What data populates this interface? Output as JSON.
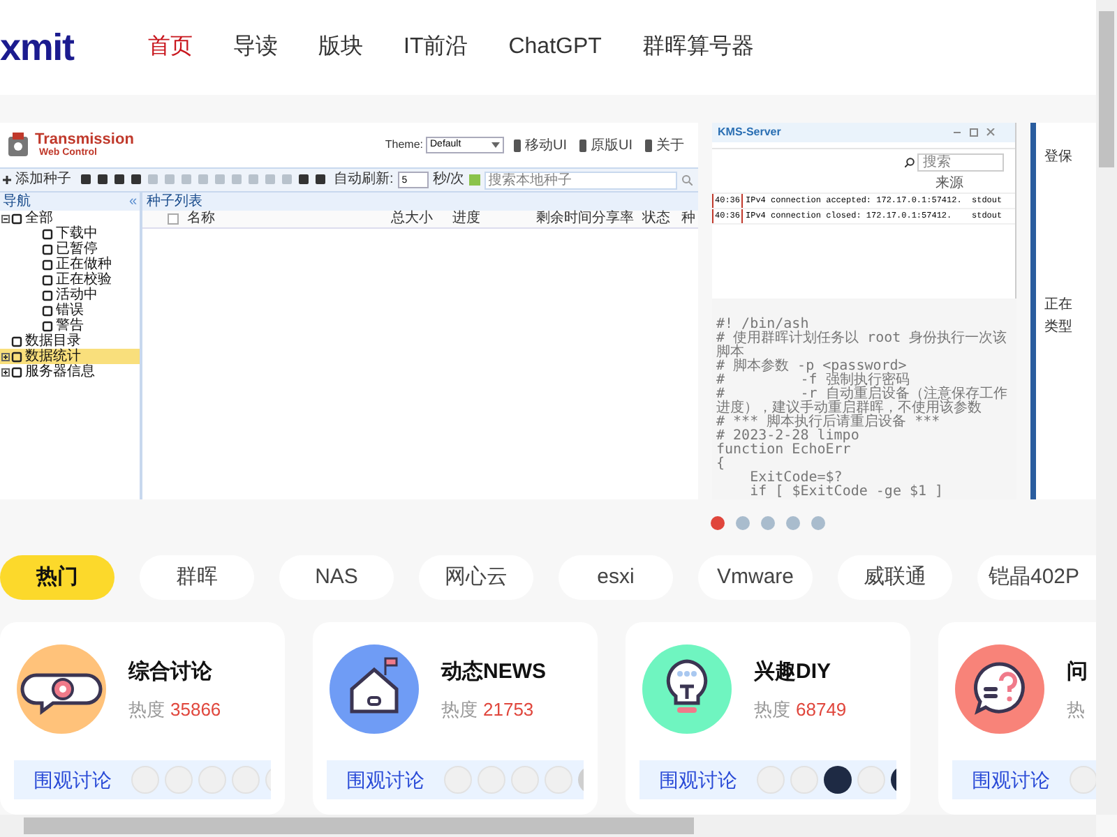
{
  "header": {
    "logo": "xmit",
    "nav": [
      {
        "label": "首页",
        "selected": true
      },
      {
        "label": "导读",
        "selected": false
      },
      {
        "label": "版块",
        "selected": false
      },
      {
        "label": "IT前沿",
        "selected": false
      },
      {
        "label": "ChatGPT",
        "selected": false
      },
      {
        "label": "群晖算号器",
        "selected": false
      }
    ]
  },
  "carousel": {
    "slides": [
      {
        "kind": "transmission",
        "app_title": "Transmission",
        "app_subtitle": "Web Control",
        "theme_label": "Theme:",
        "theme_value": "Default",
        "links": [
          "移动UI",
          "原版UI",
          "关于"
        ],
        "add_button": "添加种子",
        "refresh_label": "自动刷新:",
        "refresh_value": "5",
        "refresh_unit": "秒/次",
        "search_placeholder": "搜索本地种子",
        "nav_title": "导航",
        "nav_collapse": "«",
        "tree": [
          {
            "label": "全部",
            "expanded": true,
            "selected": false,
            "children": [
              {
                "label": "下载中",
                "selected": false
              },
              {
                "label": "已暂停",
                "selected": false
              },
              {
                "label": "正在做种",
                "selected": false
              },
              {
                "label": "正在校验",
                "selected": false
              },
              {
                "label": "活动中",
                "selected": false
              },
              {
                "label": "错误",
                "selected": false
              },
              {
                "label": "警告",
                "selected": false
              }
            ]
          },
          {
            "label": "数据目录",
            "selected": false
          },
          {
            "label": "数据统计",
            "expanded": false,
            "selected": true
          },
          {
            "label": "服务器信息",
            "expanded": false,
            "selected": false
          }
        ],
        "list_title": "种子列表",
        "columns": [
          "名称",
          "总大小",
          "进度",
          "剩余时间",
          "分享率",
          "状态",
          "种"
        ]
      },
      {
        "kind": "kms",
        "window_title": "KMS-Server",
        "search_placeholder": "搜索",
        "source_column": "来源",
        "log_rows": [
          {
            "time": "40:36",
            "message": "IPv4 connection accepted: 172.17.0.1:57412.",
            "source": "stdout"
          },
          {
            "time": "40:36",
            "message": "IPv4 connection closed: 172.17.0.1:57412.",
            "source": "stdout"
          }
        ],
        "script_lines": [
          "#! /bin/ash",
          "# 使用群晖计划任务以 root 身份执行一次该脚本",
          "# 脚本参数 -p <password>",
          "#         -f 强制执行密码",
          "#         -r 自动重启设备（注意保存工作进度），建议手动重启群晖，不使用该参数",
          "# *** 脚本执行后请重启设备 ***",
          "# 2023-2-28 limpo",
          "function EchoErr",
          "{",
          "    ExitCode=$?",
          "    if [ $ExitCode -ge $1 ]"
        ]
      },
      {
        "kind": "panel",
        "labels": [
          "登保",
          "正在",
          "类型"
        ]
      }
    ],
    "dots": [
      {
        "selected": true
      },
      {
        "selected": false
      },
      {
        "selected": false
      },
      {
        "selected": false
      },
      {
        "selected": false
      }
    ]
  },
  "tabs": [
    {
      "label": "热门",
      "selected": true
    },
    {
      "label": "群晖",
      "selected": false
    },
    {
      "label": "NAS",
      "selected": false
    },
    {
      "label": "网心云",
      "selected": false
    },
    {
      "label": "esxi",
      "selected": false
    },
    {
      "label": "Vmware",
      "selected": false
    },
    {
      "label": "威联通",
      "selected": false
    },
    {
      "label": "铠晶402P",
      "selected": false
    }
  ],
  "cards": [
    {
      "kind": "chat-gear",
      "title": "综合讨论",
      "heat_label": "热度",
      "heat_value": "35866",
      "link": "围观讨论"
    },
    {
      "kind": "house",
      "title": "动态NEWS",
      "heat_label": "热度",
      "heat_value": "21753",
      "link": "围观讨论"
    },
    {
      "kind": "bulb",
      "title": "兴趣DIY",
      "heat_label": "热度",
      "heat_value": "68749",
      "link": "围观讨论"
    },
    {
      "kind": "question",
      "title": "问",
      "heat_label": "热",
      "link": "围观讨论"
    }
  ]
}
